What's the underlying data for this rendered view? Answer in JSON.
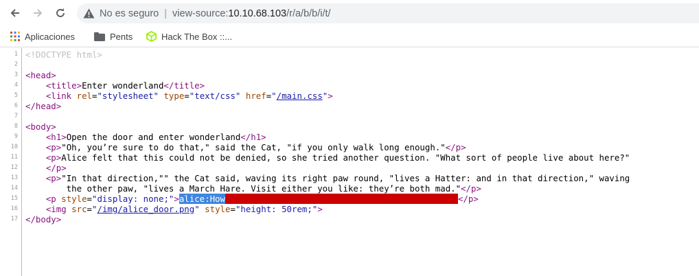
{
  "nav": {
    "back_icon": "arrow-left-icon",
    "forward_icon": "arrow-right-icon",
    "reload_icon": "reload-icon"
  },
  "omnibox": {
    "security_label": "No es seguro",
    "separator": "|",
    "url_prefix": "view-source:",
    "url_host": "10.10.68.103",
    "url_path": "/r/a/b/b/i/t/"
  },
  "bookmarks": [
    {
      "label": "Aplicaciones",
      "icon": "apps-grid-icon"
    },
    {
      "label": "Pents",
      "icon": "folder-icon"
    },
    {
      "label": "Hack The Box ::...",
      "icon": "htb-cube-icon"
    }
  ],
  "source": {
    "line_numbers": [
      "1",
      "2",
      "3",
      "4",
      "5",
      "6",
      "7",
      "8",
      "9",
      "10",
      "11",
      "12",
      "13",
      "14",
      "15",
      "16",
      "17"
    ],
    "doctype": "<!DOCTYPE html>",
    "l3": {
      "open": "<head>"
    },
    "l4": {
      "open": "<title>",
      "text": "Enter wonderland",
      "close": "</title>"
    },
    "l5": {
      "open": "<link ",
      "a1": "rel",
      "v1": "\"stylesheet\"",
      "a2": "type",
      "v2": "\"text/css\"",
      "a3": "href",
      "q": "\"",
      "href": "/main.css",
      "end": ">"
    },
    "l6": {
      "close": "</head>"
    },
    "l8": {
      "open": "<body>"
    },
    "l9": {
      "open": "<h1>",
      "text": "Open the door and enter wonderland",
      "close": "</h1>"
    },
    "l10": {
      "open": "<p>",
      "text": "\"Oh, you’re sure to do that,\" said the Cat, \"if you only walk long enough.\"",
      "close": "</p>"
    },
    "l11": {
      "open": "<p>",
      "text": "Alice felt that this could not be denied, so she tried another question. \"What sort of people live about here?\"",
      "close": "</p>"
    },
    "l12": {
      "close": "</p>"
    },
    "l13": {
      "open": "<p>",
      "text": "\"In that direction,\"\" the Cat said, waving its right paw round, \"lives a Hatter: and in that direction,\" waving"
    },
    "l14": {
      "text": "    the other paw, \"lives a March Hare. Visit either you like: they’re both mad.\"",
      "close": "</p>"
    },
    "l15": {
      "open": "<p ",
      "a1": "style",
      "v1": "\"display: none;\"",
      "end": ">",
      "selected": "alice:How",
      "close": "</p>"
    },
    "l16": {
      "open": "<img ",
      "a1": "src",
      "q": "\"",
      "src": "/img/alice_door.png",
      "a2": "style",
      "v2": "\"height: 50rem;\"",
      "end": ">"
    },
    "l17": {
      "close": "</body>"
    }
  },
  "colors": {
    "tag": "#881280",
    "attribute": "#994500",
    "value": "#1a1aa6",
    "redaction": "#cc0000",
    "selection": "#3f86e0"
  }
}
